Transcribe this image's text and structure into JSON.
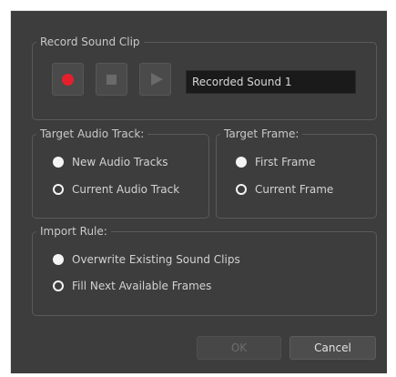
{
  "record_group": {
    "legend": "Record Sound Clip",
    "clip_name": "Recorded Sound 1"
  },
  "track_group": {
    "legend": "Target Audio Track:",
    "options": [
      {
        "label": "New Audio Tracks",
        "selected": false
      },
      {
        "label": "Current Audio Track",
        "selected": true
      }
    ]
  },
  "frame_group": {
    "legend": "Target Frame:",
    "options": [
      {
        "label": "First Frame",
        "selected": false
      },
      {
        "label": "Current Frame",
        "selected": true
      }
    ]
  },
  "import_group": {
    "legend": "Import Rule:",
    "options": [
      {
        "label": "Overwrite Existing Sound Clips",
        "selected": false
      },
      {
        "label": "Fill Next Available Frames",
        "selected": true
      }
    ]
  },
  "buttons": {
    "ok": "OK",
    "cancel": "Cancel"
  },
  "colors": {
    "dialog_bg": "#3d3d3d",
    "record_red": "#e5202d",
    "field_bg": "#1a1a1a"
  },
  "icons": {
    "record": "record-icon",
    "stop": "stop-icon",
    "play": "play-icon"
  }
}
